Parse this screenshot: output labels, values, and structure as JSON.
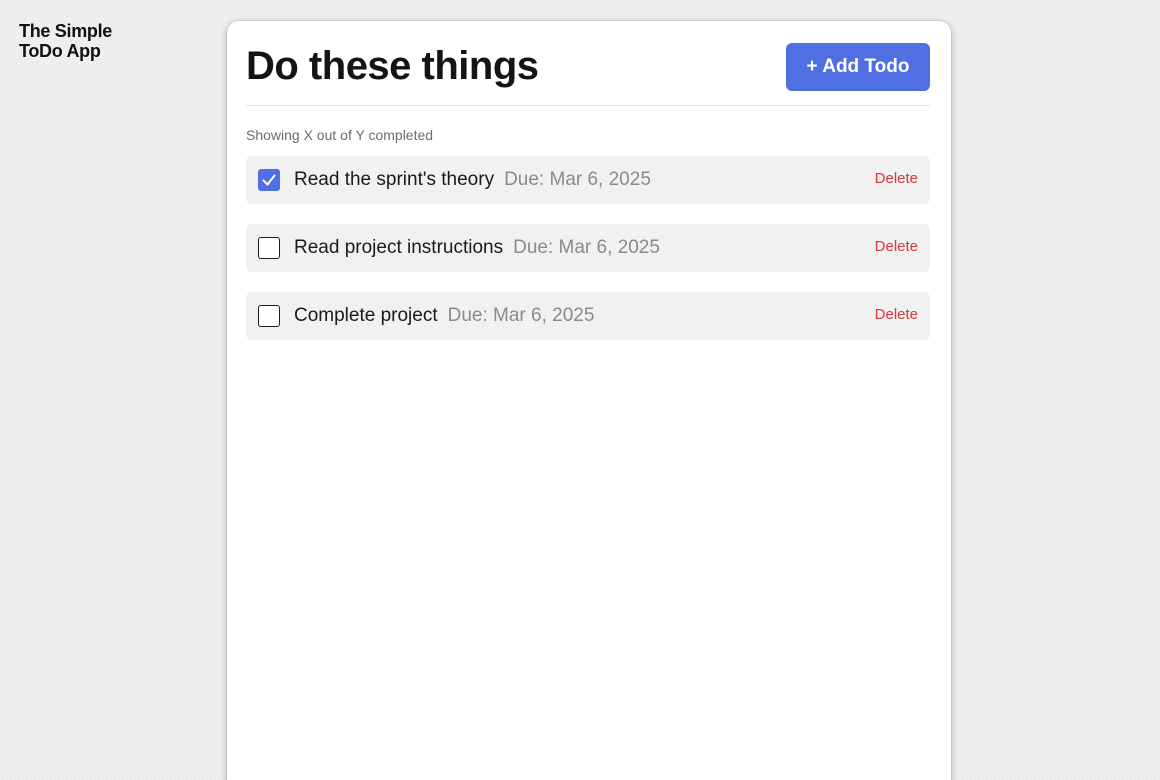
{
  "app": {
    "name_line1": "The Simple",
    "name_line2": "ToDo App"
  },
  "header": {
    "title": "Do these things",
    "add_label": "+ Add Todo"
  },
  "summary": "Showing X out of Y completed",
  "todos": [
    {
      "text": "Read the sprint's theory",
      "due": "Due: Mar 6, 2025",
      "completed": true,
      "delete_label": "Delete"
    },
    {
      "text": "Read project instructions",
      "due": "Due: Mar 6, 2025",
      "completed": false,
      "delete_label": "Delete"
    },
    {
      "text": "Complete project",
      "due": "Due: Mar 6, 2025",
      "completed": false,
      "delete_label": "Delete"
    }
  ],
  "colors": {
    "accent": "#4f6fe3",
    "danger": "#d9363e",
    "muted": "#8a8a8a"
  },
  "icons": {
    "check": "check-icon"
  }
}
